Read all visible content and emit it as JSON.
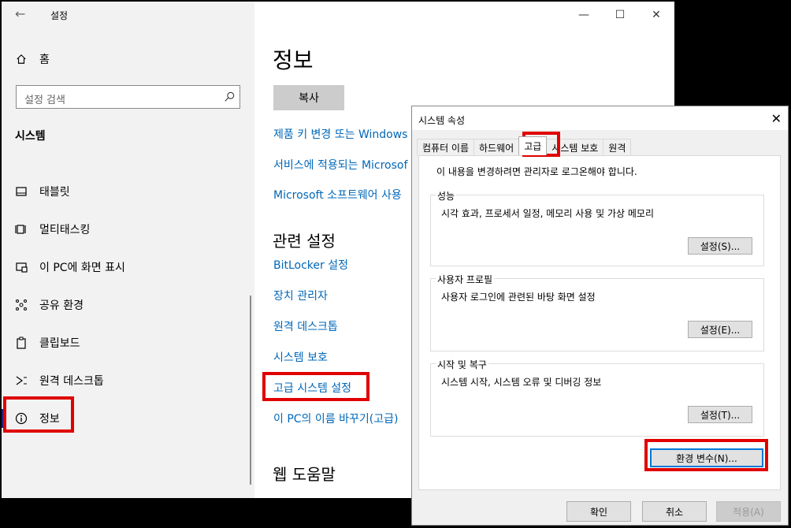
{
  "settings_window": {
    "title": "설정",
    "home_label": "홈",
    "search_placeholder": "설정 검색",
    "section_label": "시스템",
    "nav_items": [
      {
        "label": "태블릿"
      },
      {
        "label": "멀티태스킹"
      },
      {
        "label": "이 PC에 화면 표시"
      },
      {
        "label": "공유 환경"
      },
      {
        "label": "클립보드"
      },
      {
        "label": "원격 데스크톱"
      },
      {
        "label": "정보"
      }
    ],
    "page_title": "정보",
    "copy_button": "복사",
    "links_top": [
      "제품 키 변경 또는 Windows",
      "서비스에 적용되는 Microsof",
      "Microsoft 소프트웨어 사용"
    ],
    "related_title": "관련 설정",
    "related_links": [
      "BitLocker 설정",
      "장치 관리자",
      "원격 데스크톱",
      "시스템 보호",
      "고급 시스템 설정",
      "이 PC의 이름 바꾸기(고급)"
    ],
    "web_help_title": "웹 도움말"
  },
  "system_properties": {
    "title": "시스템 속성",
    "tabs": [
      "컴퓨터 이름",
      "하드웨어",
      "고급",
      "시스템 보호",
      "원격"
    ],
    "active_tab": "고급",
    "admin_note": "이 내용을 변경하려면 관리자로 로그온해야 합니다.",
    "groups": [
      {
        "title": "성능",
        "desc": "시각 효과, 프로세서 일정, 메모리 사용 및 가상 메모리",
        "button": "설정(S)..."
      },
      {
        "title": "사용자 프로필",
        "desc": "사용자 로그인에 관련된 바탕 화면 설정",
        "button": "설정(E)..."
      },
      {
        "title": "시작 및 복구",
        "desc": "시스템 시작, 시스템 오류 및 디버깅 정보",
        "button": "설정(T)..."
      }
    ],
    "env_button": "환경 변수(N)...",
    "ok_button": "확인",
    "cancel_button": "취소",
    "apply_button": "적용(A)"
  },
  "colors": {
    "link": "#0067b8",
    "highlight": "#e00000",
    "accent": "#1f1f7a"
  }
}
